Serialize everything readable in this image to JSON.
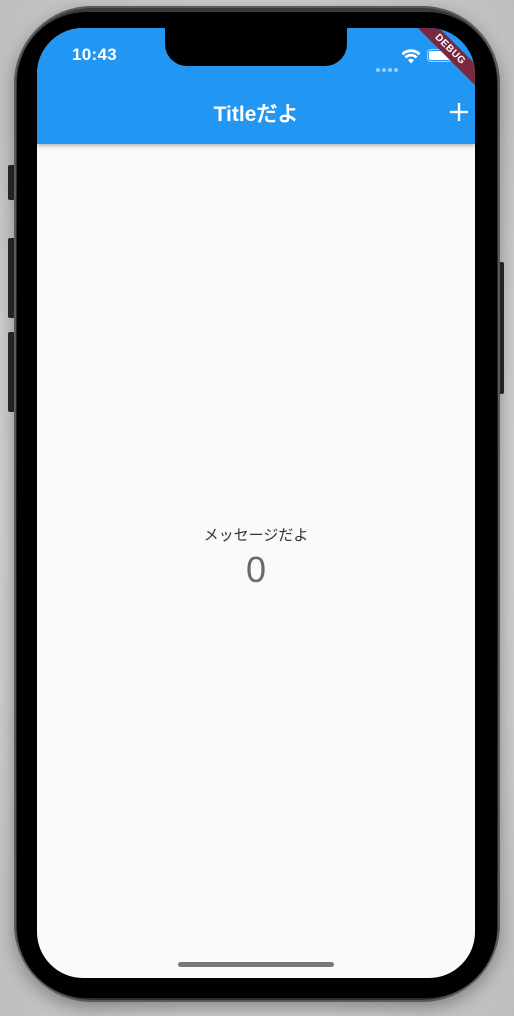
{
  "status_bar": {
    "time": "10:43",
    "icons": [
      "signal-dots-icon",
      "wifi-icon",
      "battery-icon"
    ]
  },
  "app_bar": {
    "title": "Titleだよ",
    "action_icon": "plus-icon",
    "background_color": "#2196f3"
  },
  "debug_banner": {
    "label": "DEBUG",
    "color": "#7a2840"
  },
  "body": {
    "message": "メッセージだよ",
    "counter": "0"
  }
}
